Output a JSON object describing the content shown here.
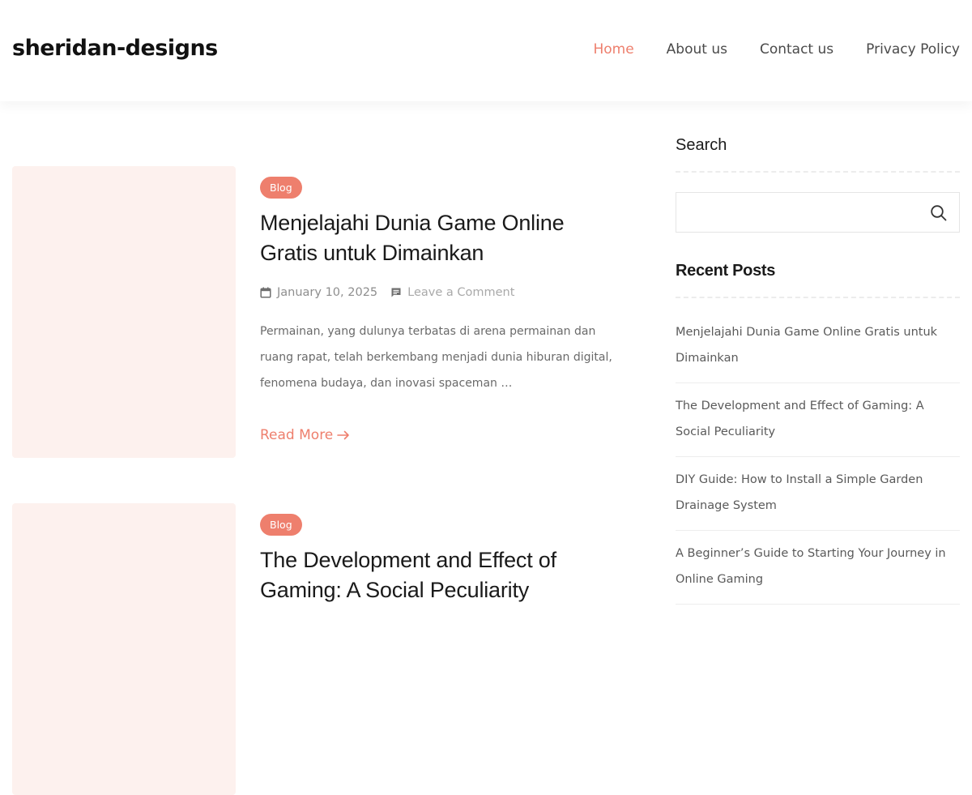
{
  "site": {
    "title": "sheridan-designs"
  },
  "nav": {
    "items": [
      "Home",
      "About us",
      "Contact us",
      "Privacy Policy"
    ],
    "active": "Home"
  },
  "posts": [
    {
      "category": "Blog",
      "title": "Menjelajahi Dunia Game Online Gratis untuk Dimainkan",
      "date": "January 10, 2025",
      "comment_label": "Leave a Comment",
      "excerpt": "Permainan, yang dulunya terbatas di arena permainan dan ruang rapat, telah berkembang menjadi dunia hiburan digital, fenomena budaya, dan inovasi spaceman …",
      "read_more": "Read More"
    },
    {
      "category": "Blog",
      "title": "The Development and Effect of Gaming: A Social Peculiarity"
    }
  ],
  "sidebar": {
    "search_title": "Search",
    "search_placeholder": "",
    "recent_title": "Recent Posts",
    "recent_posts": [
      "Menjelajahi Dunia Game Online Gratis untuk Dimainkan",
      "The Development and Effect of Gaming: A Social Peculiarity",
      "DIY Guide: How to Install a Simple Garden Drainage System",
      "A Beginner’s Guide to Starting Your Journey in Online Gaming"
    ]
  },
  "icons": {
    "date": "calendar-icon",
    "comment": "comment-icon",
    "read_more": "arrow-right-icon",
    "search": "search-icon"
  },
  "colors": {
    "accent": "#ee7f6d",
    "thumbnail_bg": "#fdf1ee",
    "heading": "#1a1a1a",
    "text": "#6a6a6a"
  }
}
